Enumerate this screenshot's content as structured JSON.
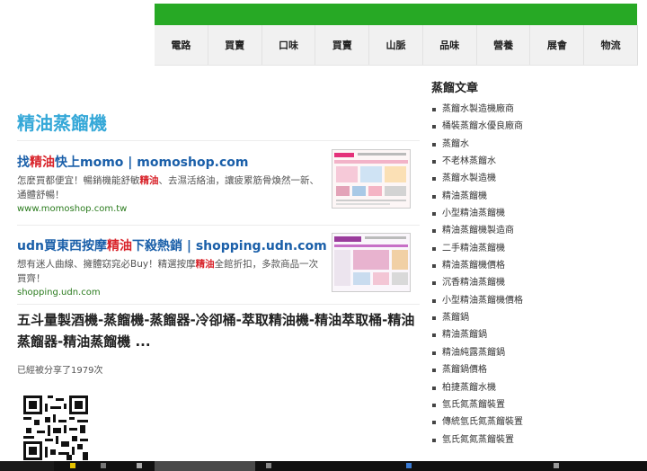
{
  "nav": {
    "items": [
      "電路",
      "買賣",
      "口味",
      "買賣",
      "山脈",
      "品味",
      "營養",
      "展會",
      "物流"
    ]
  },
  "main": {
    "title": "精油蒸餾機",
    "ads": [
      {
        "title_pre": "找",
        "title_hl": "精油",
        "title_post": "快上momo | momoshop.com",
        "desc_pre": "怎麼買都便宜！暢銷機能舒敏",
        "desc_hl": "精油",
        "desc_post": "、去濕活絡油，讓疲累筋骨煥然一新、通體舒暢！",
        "url": "www.momoshop.com.tw"
      },
      {
        "title_pre": "udn買東西按摩",
        "title_hl": "精油",
        "title_post": "下殺熱銷 | shopping.udn.com",
        "desc_pre": "想有迷人曲線、擁體窈窕必Buy！精選按摩",
        "desc_hl": "精油",
        "desc_post": "全館折扣，多款商品一次買齊！",
        "url": "shopping.udn.com"
      }
    ],
    "article_title": "五斗量製酒機-蒸餾機-蒸餾器-冷卻桶-萃取精油機-精油萃取桶-精油蒸餾器-精油蒸餾機 ...",
    "share_text": "已經被分享了1979次"
  },
  "sidebar": {
    "heading": "蒸餾文章",
    "items": [
      "蒸餾水製造機廠商",
      "桶裝蒸餾水優良廠商",
      "蒸餾水",
      "不老林蒸餾水",
      "蒸餾水製造機",
      "精油蒸餾機",
      "小型精油蒸餾機",
      "精油蒸餾機製造商",
      "二手精油蒸餾機",
      "精油蒸餾機價格",
      "沉香精油蒸餾機",
      "小型精油蒸餾機價格",
      "蒸餾鍋",
      "精油蒸餾鍋",
      "精油純露蒸餾鍋",
      "蒸餾鍋價格",
      "柏捷蒸餾水機",
      "氫氏氮蒸餾裝置",
      "傳統氫氏氮蒸餾裝置",
      "氫氏氮氮蒸餾裝置"
    ]
  },
  "colors": {
    "topbar": "#27a925",
    "title_blue": "#35a8d8",
    "link_blue": "#1a5fa9",
    "highlight_red": "#d8232a",
    "url_green": "#2a7b1d"
  }
}
